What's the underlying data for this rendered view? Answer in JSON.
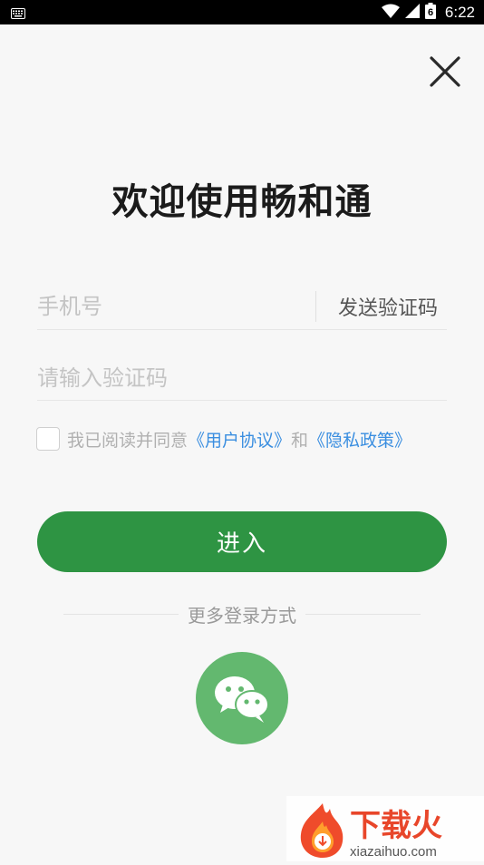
{
  "status_bar": {
    "time": "6:22",
    "battery_level": "6"
  },
  "login": {
    "title": "欢迎使用畅和通",
    "phone_placeholder": "手机号",
    "send_code_label": "发送验证码",
    "code_placeholder": "请输入验证码",
    "agreement": {
      "prefix": "我已阅读并同意",
      "user_agreement": "《用户协议》",
      "conjunction": "和",
      "privacy_policy": "《隐私政策》"
    },
    "enter_label": "进入",
    "more_methods_label": "更多登录方式"
  },
  "watermark": {
    "brand": "下载火",
    "url": "xiazaihuo.com"
  },
  "colors": {
    "primary_green": "#2e9443",
    "wechat_green": "#63b86f",
    "link_blue": "#3a8ee0"
  }
}
